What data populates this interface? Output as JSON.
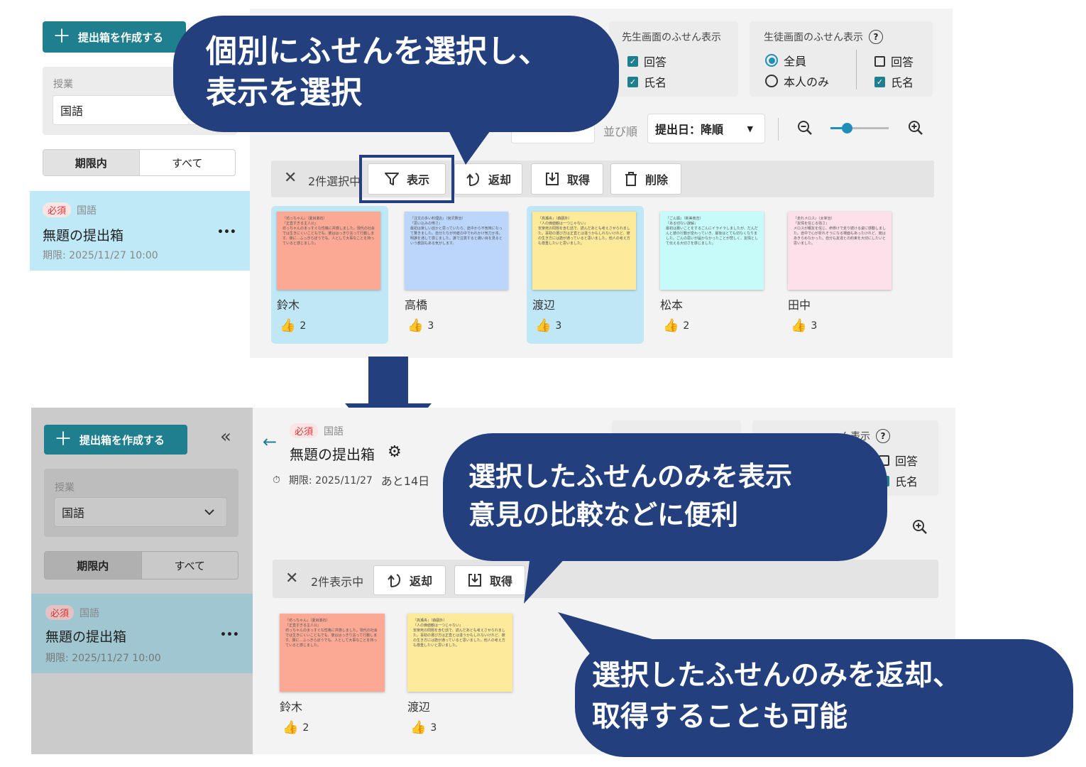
{
  "top": {
    "create_button": "提出箱を作成する",
    "class_label": "授業",
    "class_value": "国語",
    "seg_active": "期限内",
    "seg_all": "すべて",
    "item": {
      "required": "必須",
      "subject": "国語",
      "title": "無題の提出箱",
      "more": "•••",
      "deadline": "期限: 2025/11/27 10:00"
    },
    "teacher_title": "先生画面のふせん表示",
    "teacher_answer": "回答",
    "teacher_name": "氏名",
    "student_title": "生徒画面のふせん表示",
    "student_all": "全員",
    "student_self": "本人のみ",
    "student_answer": "回答",
    "student_name": "氏名",
    "sort_label": "並び順",
    "sort_value": "提出日：降順",
    "selection_count": "2件選択中",
    "btn_show": "表示",
    "btn_return": "返却",
    "btn_get": "取得",
    "btn_delete": "削除",
    "cards": [
      {
        "name": "鈴木",
        "likes": "2",
        "color": "#fba894",
        "selected": true,
        "text": "『坊っちゃん』（夏目漱石）\n『正直すぎる主人公』\n坊っちゃんのまっすぐな性格に共感しました。現代の社会では生きにくいこともでも、彼ははっきり言って行動します。弾に…ふっきらぼうでも、人として大事なことを持っていると感じました。"
      },
      {
        "name": "高橋",
        "likes": "3",
        "color": "#bcd6fb",
        "selected": false,
        "text": "『注文の多い料理店』（宮沢賢治）\n『思い込みの怖さ』\n最初は楽しい話かと思っていたら、途中から不気味になって驚きました。自分たちが何者の中でわれかけ気力か本。明誰を通して感じました。誰で注意すると痛い目を見るという教訓もある気がします。"
      },
      {
        "name": "渡辺",
        "likes": "3",
        "color": "#fdeb9b",
        "selected": true,
        "text": "『高瀬舟』（森鷗外）\n『人の価値観は一つじゃない』\n安楽死の問題を含む話で、読んだあとも考えさせられました。喜助の選び方は正直とは違うかもしれないけれど、彼の生き方には筋が通っていると思いました。他人の考え方も尊重したいと思いました。"
      },
      {
        "name": "松本",
        "likes": "2",
        "color": "#c6fbf9",
        "selected": false,
        "text": "『ごん狐』（新美南吉）\n『ある切ない誤解』\n最初は悪いことをするごんにイライラしましたが、だんだんと彼の行動が変わっていき、最後はとても切なくなりました。ごんの思いが届かなかったことが悲しく、友情として伝える大切さを感じました。"
      },
      {
        "name": "田中",
        "likes": "3",
        "color": "#fde0ea",
        "selected": false,
        "text": "『走れメロス』（太宰治）\n『友情を信じる強さ』\nメロスが親友を信じ、命懸けで走り続ける姿に感動しました。途中で心が折れそうになる場面もあったけれど、彼はあきらめなかった。自分も友達との約束を大切にしたいと思いました。"
      }
    ]
  },
  "bubble1": {
    "line1": "個別にふせんを選択し、",
    "line2": "表示を選択"
  },
  "bottom": {
    "create_button": "提出箱を作成する",
    "collapse": "«",
    "class_label": "授業",
    "class_value": "国語",
    "seg_active": "期限内",
    "seg_all": "すべて",
    "item": {
      "required": "必須",
      "subject": "国語",
      "title": "無題の提出箱",
      "more": "•••",
      "deadline": "期限: 2025/11/27 10:00"
    },
    "header": {
      "required": "必須",
      "subject": "国語",
      "title": "無題の提出箱",
      "deadline": "期限: 2025/11/27",
      "remaining": "あと14日"
    },
    "student_title_partial": "ん表示",
    "student_answer": "回答",
    "student_name": "氏名",
    "display_count": "2件表示中",
    "btn_return": "返却",
    "btn_get": "取得",
    "cards": [
      {
        "name": "鈴木",
        "likes": "2",
        "color": "#fba894",
        "text": "『坊っちゃん』（夏目漱石）\n『正直すぎる主人公』\n坊っちゃんのまっすぐな性格に共感しました。現代の社会では生きにくいこともでも、彼ははっきり言って行動します。弾に…ふっきらぼうでも、人として大事なことを持っていると感じました。"
      },
      {
        "name": "渡辺",
        "likes": "3",
        "color": "#fdeb9b",
        "text": "『高瀬舟』（森鷗外）\n『人の価値観は一つじゃない』\n安楽死の問題を含む話で、読んだあとも考えさせられました。喜助の選び方は正直とは違うかもしれないけれど、彼の生き方には筋が通っていると思いました。他人の考え方も尊重したいと思いました。"
      }
    ]
  },
  "bubble2": {
    "line1": "選択したふせんのみを表示",
    "line2": "意見の比較などに便利"
  },
  "bubble3": {
    "line1": "選択したふせんのみを返却、",
    "line2": "取得することも可能"
  },
  "colors": {
    "accent": "#1f7f8f",
    "bubble": "#233f7d",
    "selected_bg": "#bfe7f5"
  }
}
